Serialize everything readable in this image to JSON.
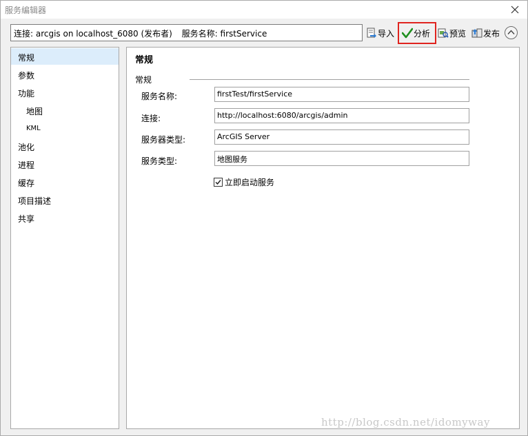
{
  "window": {
    "title": "服务编辑器"
  },
  "connection": {
    "text": "连接: arcgis on localhost_6080 (发布者)",
    "service_text": "服务名称: firstService"
  },
  "toolbar": {
    "import_label": "导入",
    "analyze_label": "分析",
    "preview_label": "预览",
    "publish_label": "发布",
    "highlight_color": "#e0231e"
  },
  "sidebar": {
    "items": [
      {
        "label": "常规"
      },
      {
        "label": "参数"
      },
      {
        "label": "功能"
      },
      {
        "label": "地图"
      },
      {
        "label": "KML"
      },
      {
        "label": "池化"
      },
      {
        "label": "进程"
      },
      {
        "label": "缓存"
      },
      {
        "label": "项目描述"
      },
      {
        "label": "共享"
      }
    ],
    "selected_color": "#dcedfb"
  },
  "main": {
    "title": "常规",
    "group_label": "常规",
    "fields": [
      {
        "label": "服务名称:",
        "value": "firstTest/firstService"
      },
      {
        "label": "连接:",
        "value": "http://localhost:6080/arcgis/admin"
      },
      {
        "label": "服务器类型:",
        "value": "ArcGIS Server"
      },
      {
        "label": "服务类型:",
        "value": "地图服务"
      }
    ],
    "checkbox_label": "立即启动服务",
    "checkbox_checked": true
  },
  "watermark": "http://blog.csdn.net/idomyway",
  "icons": [
    "close-icon",
    "import-icon",
    "checkmark-icon",
    "preview-icon",
    "publish-icon",
    "chevron-up-icon"
  ]
}
